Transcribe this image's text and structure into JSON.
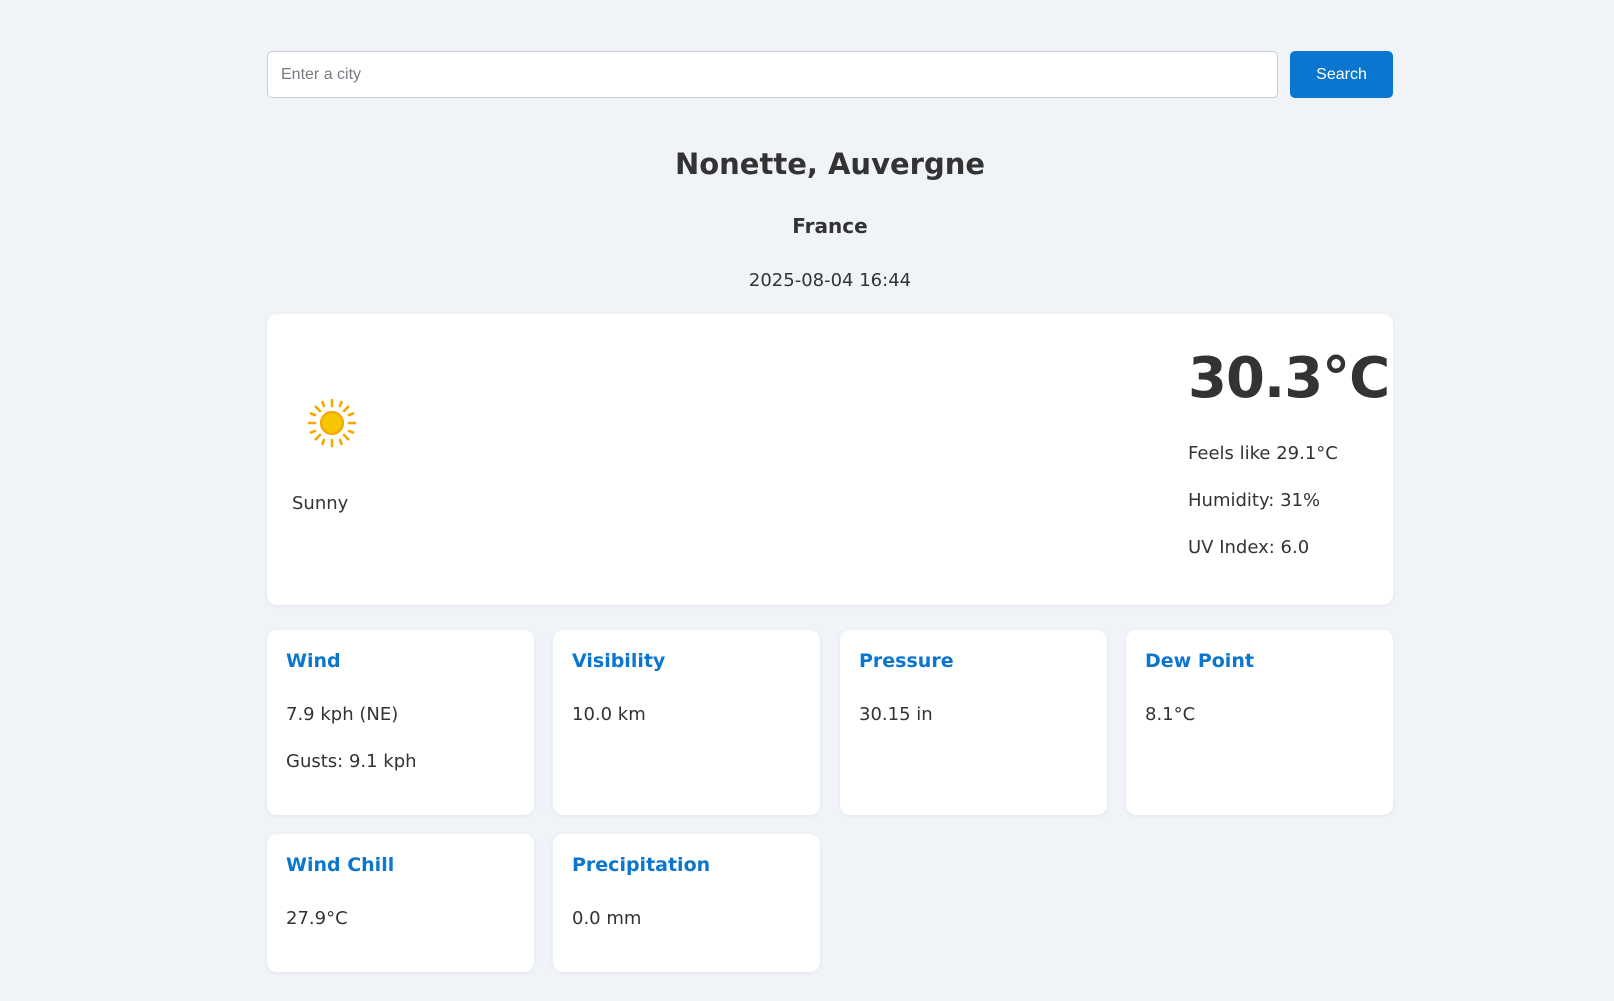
{
  "search": {
    "placeholder": "Enter a city",
    "value": "",
    "button_label": "Search"
  },
  "location": {
    "title": "Nonette, Auvergne",
    "country": "France",
    "local_time": "2025-08-04 16:44"
  },
  "current": {
    "icon": "sun-icon",
    "condition": "Sunny",
    "temperature": "30.3°C",
    "feels_like": "Feels like 29.1°C",
    "humidity": "Humidity: 31%",
    "uv_index": "UV Index: 6.0"
  },
  "details": [
    {
      "title": "Wind",
      "lines": [
        "7.9 kph (NE)",
        "Gusts: 9.1 kph"
      ]
    },
    {
      "title": "Visibility",
      "lines": [
        "10.0 km"
      ]
    },
    {
      "title": "Pressure",
      "lines": [
        "30.15 in"
      ]
    },
    {
      "title": "Dew Point",
      "lines": [
        "8.1°C"
      ]
    },
    {
      "title": "Wind Chill",
      "lines": [
        "27.9°C"
      ]
    },
    {
      "title": "Precipitation",
      "lines": [
        "0.0 mm"
      ]
    }
  ],
  "colors": {
    "accent": "#0a76d0",
    "background": "#f0f3f8",
    "card": "#ffffff",
    "text": "#333333",
    "sun": "#f7c600"
  }
}
